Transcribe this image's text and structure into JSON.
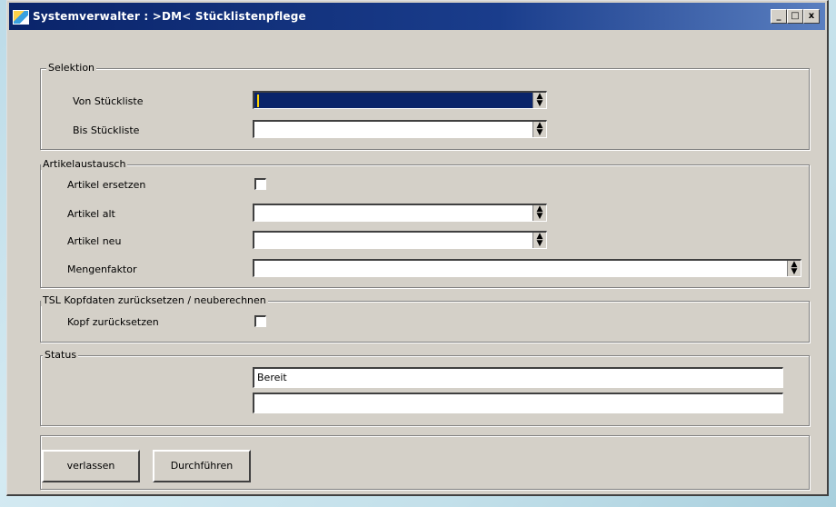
{
  "window": {
    "title": "Systemverwalter :  >DM< Stücklistenpflege",
    "minimize": "_",
    "maximize": "□",
    "close": "x"
  },
  "selektion": {
    "title": "Selektion",
    "von_label": "Von Stückliste",
    "von_value": "",
    "bis_label": "Bis Stückliste",
    "bis_value": ""
  },
  "artikelaustausch": {
    "title": "Artikelaustausch",
    "ersetzen_label": "Artikel ersetzen",
    "ersetzen_checked": false,
    "alt_label": "Artikel alt",
    "alt_value": "",
    "neu_label": "Artikel neu",
    "neu_value": "",
    "menge_label": "Mengenfaktor",
    "menge_value": ""
  },
  "kopfdaten": {
    "title": "TSL Kopfdaten zurücksetzen / neuberechnen",
    "label": "Kopf zurücksetzen",
    "checked": false
  },
  "status": {
    "title": "Status",
    "line1": "Bereit",
    "line2": ""
  },
  "buttons": {
    "verlassen": "verlassen",
    "durchfuehren": "Durchführen"
  },
  "colors": {
    "titlebar": "#0a246a",
    "window_bg": "#d4d0c8"
  }
}
